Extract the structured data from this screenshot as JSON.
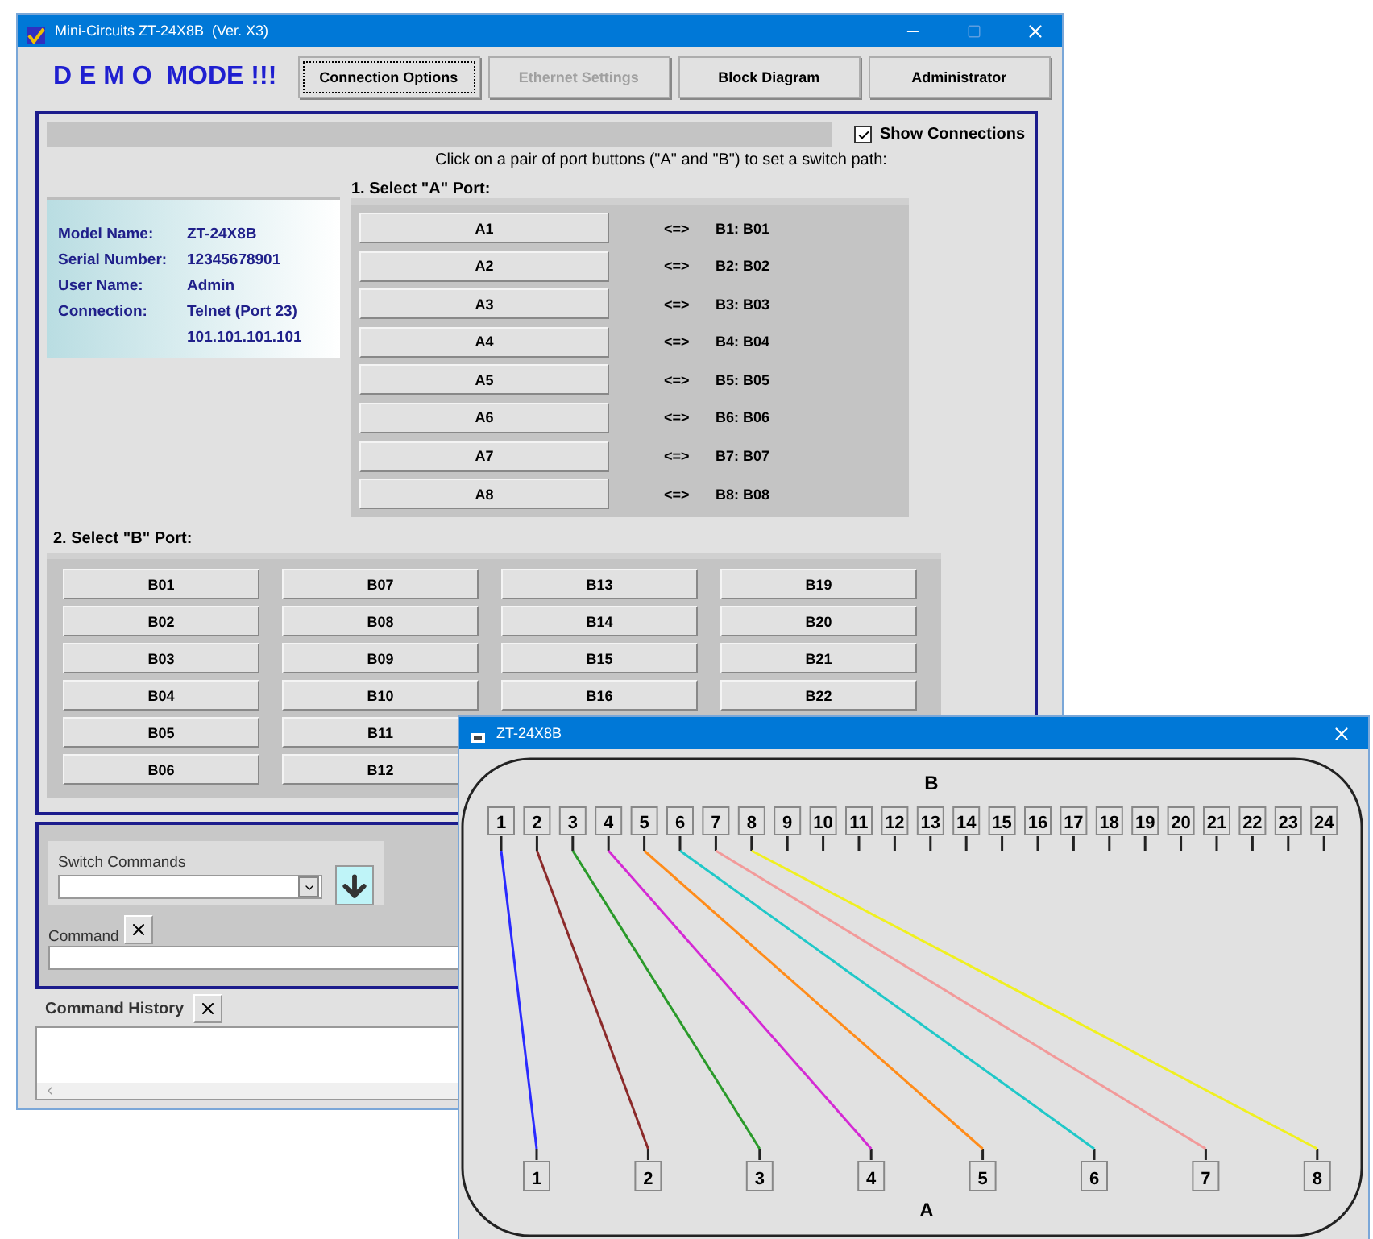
{
  "main_window": {
    "title": "Mini-Circuits ZT-24X8B  (Ver. X3)",
    "mode_label": "D E M O  MODE !!!",
    "toolbar": [
      {
        "label": "Connection Options",
        "focused": true,
        "disabled": false
      },
      {
        "label": "Ethernet Settings",
        "focused": false,
        "disabled": true
      },
      {
        "label": "Block Diagram",
        "focused": false,
        "disabled": false
      },
      {
        "label": "Administrator",
        "focused": false,
        "disabled": false
      }
    ],
    "show_connections": {
      "label": "Show Connections",
      "checked": true
    },
    "instruction": "Click on a pair of port buttons (\"A\" and \"B\") to set a switch path:",
    "info": [
      {
        "label": "Model Name:",
        "value": "ZT-24X8B"
      },
      {
        "label": "Serial Number:",
        "value": "12345678901"
      },
      {
        "label": "User Name:",
        "value": "Admin"
      },
      {
        "label": "Connection:",
        "value": "Telnet (Port 23)"
      },
      {
        "value": "101.101.101.101"
      }
    ],
    "a_section": {
      "title": "1. Select \"A\" Port:",
      "ports": [
        {
          "label": "A1",
          "link": "<=>",
          "target": "B1: B01"
        },
        {
          "label": "A2",
          "link": "<=>",
          "target": "B2: B02"
        },
        {
          "label": "A3",
          "link": "<=>",
          "target": "B3: B03"
        },
        {
          "label": "A4",
          "link": "<=>",
          "target": "B4: B04"
        },
        {
          "label": "A5",
          "link": "<=>",
          "target": "B5: B05"
        },
        {
          "label": "A6",
          "link": "<=>",
          "target": "B6: B06"
        },
        {
          "label": "A7",
          "link": "<=>",
          "target": "B7: B07"
        },
        {
          "label": "A8",
          "link": "<=>",
          "target": "B8: B08"
        }
      ]
    },
    "b_section": {
      "title": "2. Select \"B\" Port:",
      "rows": [
        [
          "B01",
          "B07",
          "B13",
          "B19"
        ],
        [
          "B02",
          "B08",
          "B14",
          "B20"
        ],
        [
          "B03",
          "B09",
          "B15",
          "B21"
        ],
        [
          "B04",
          "B10",
          "B16",
          "B22"
        ],
        [
          "B05",
          "B11"
        ],
        [
          "B06",
          "B12"
        ]
      ]
    },
    "commands": {
      "switch_label": "Switch Commands",
      "command_label": "Command",
      "history_label": "Command History"
    }
  },
  "diagram_window": {
    "title": "ZT-24X8B",
    "b_label": "B",
    "a_label": "A",
    "b_ports": [
      "1",
      "2",
      "3",
      "4",
      "5",
      "6",
      "7",
      "8",
      "9",
      "10",
      "11",
      "12",
      "13",
      "14",
      "15",
      "16",
      "17",
      "18",
      "19",
      "20",
      "21",
      "22",
      "23",
      "24"
    ],
    "a_ports": [
      "1",
      "2",
      "3",
      "4",
      "5",
      "6",
      "7",
      "8"
    ],
    "connections": [
      {
        "color": "#2a2aff"
      },
      {
        "color": "#8b2a2a"
      },
      {
        "color": "#2a9a2a"
      },
      {
        "color": "#d42ad4"
      },
      {
        "color": "#ff8c1a"
      },
      {
        "color": "#20c8c8"
      },
      {
        "color": "#f29a9a"
      },
      {
        "color": "#f0f020"
      }
    ]
  }
}
